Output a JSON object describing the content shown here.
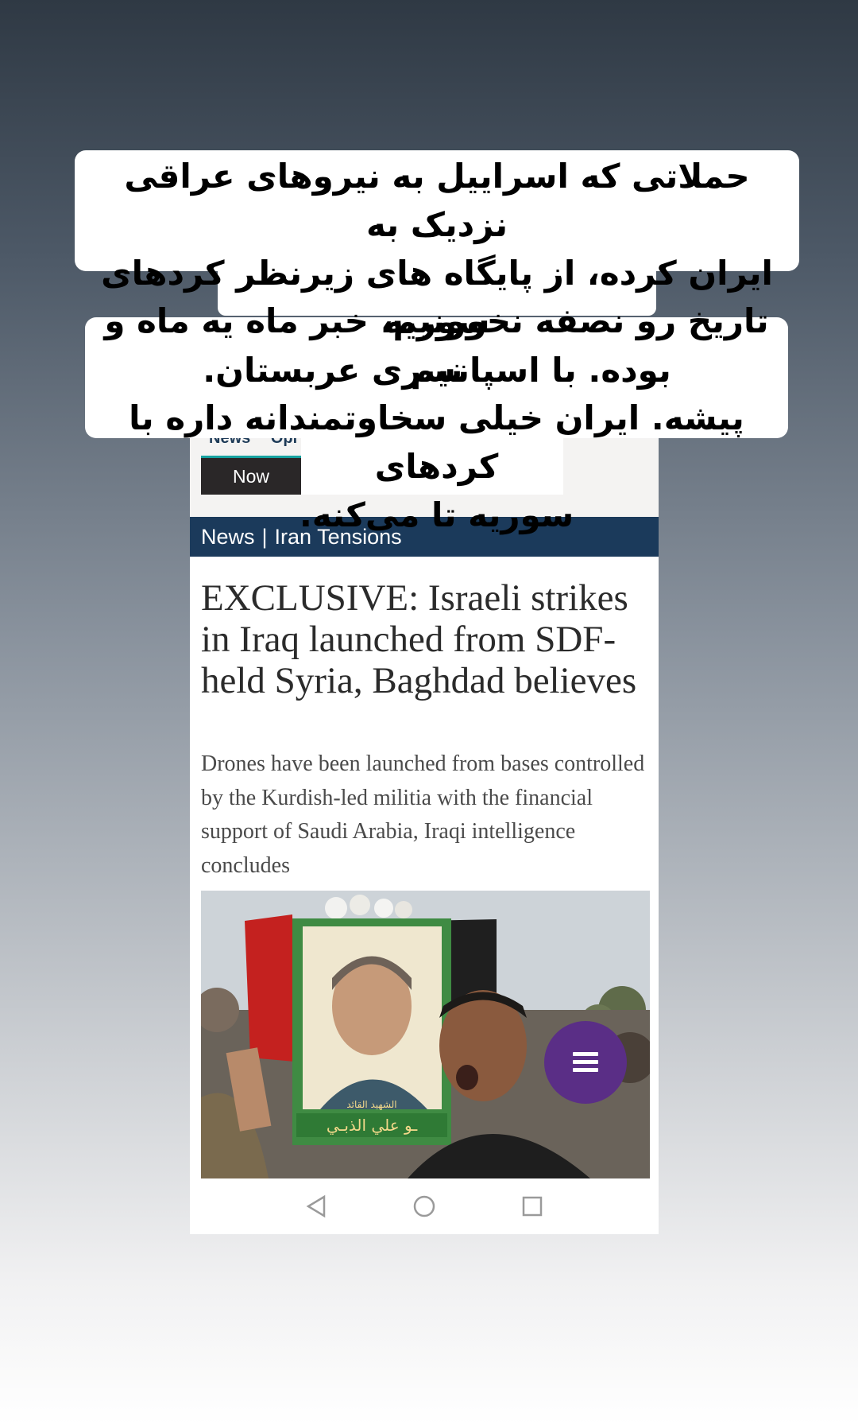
{
  "caption": {
    "paragraph1_line1": "حملاتی که اسراییل به نیروهای عراقی نزدیک به",
    "paragraph1_line2": "ایران کرده، از پایگاه های زیرنظر کردهای سوریه",
    "paragraph1_line3": "بوده. با اسپانسری عربستان.",
    "paragraph2_line1": "تاریخ رو نصفه نخوونیم، خبر ماه یه ماه و نیم",
    "paragraph2_line2": "پیشه. ایران خیلی سخاوتمندانه داره با کردهای",
    "paragraph2_line3": "سوریه تا می‌کنه."
  },
  "site": {
    "nav_tabs": [
      "News",
      "Opi"
    ],
    "now_button": "Now",
    "section": "News",
    "separator": "|",
    "subsection": "Iran Tensions"
  },
  "article": {
    "headline": "EXCLUSIVE: Israeli strikes in Iraq launched from SDF-held Syria, Baghdad believes",
    "standfirst": "Drones have been launched from bases controlled by the Kurdish-led militia with the financial support of Saudi Arabia, Iraqi intelligence concludes",
    "photo_caption_arabic_1": "الشهيد القائد",
    "photo_caption_arabic_2": "ـو علي الذبـي"
  },
  "icons": {
    "menu": "hamburger-menu-icon",
    "back": "back-triangle-icon",
    "home": "home-circle-icon",
    "recents": "recents-square-icon"
  },
  "colors": {
    "section_bar": "#1b3a5b",
    "menu_fab": "#5a2e86",
    "now_button": "#2a2728"
  }
}
